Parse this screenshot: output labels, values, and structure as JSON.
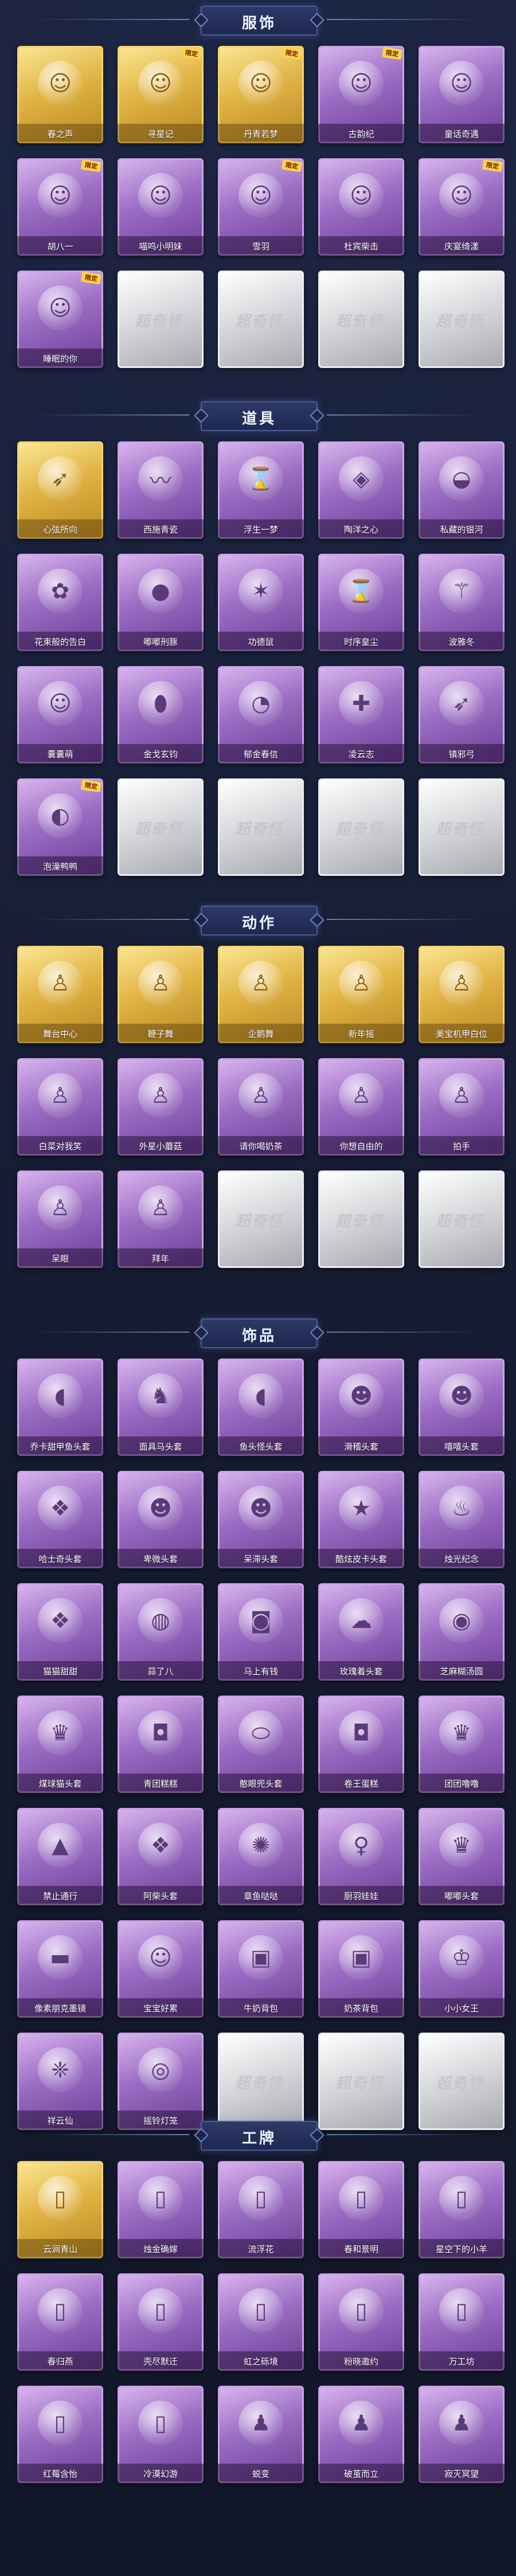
{
  "watermark": "超奇怪",
  "colors": {
    "background": "#161d33",
    "gold": "#e1b444",
    "purple": "#9a6cc3",
    "silver": "#d9dadd"
  },
  "sections": [
    {
      "title": "服饰",
      "items": [
        {
          "label": "春之声",
          "rarity": "gold",
          "icon": "character-icon",
          "tag": ""
        },
        {
          "label": "寻星记",
          "rarity": "gold",
          "icon": "character-icon",
          "tag": "限定"
        },
        {
          "label": "丹青若梦",
          "rarity": "gold",
          "icon": "character-icon",
          "tag": "限定"
        },
        {
          "label": "古韵纪",
          "rarity": "purple",
          "icon": "character-icon",
          "tag": "限定"
        },
        {
          "label": "童话奇遇",
          "rarity": "purple",
          "icon": "character-icon",
          "tag": ""
        },
        {
          "label": "胡八一",
          "rarity": "purple",
          "icon": "character-icon",
          "tag": "限定"
        },
        {
          "label": "喵呜小明妹",
          "rarity": "purple",
          "icon": "character-icon",
          "tag": ""
        },
        {
          "label": "雪羽",
          "rarity": "purple",
          "icon": "character-icon",
          "tag": "限定"
        },
        {
          "label": "杜宾柴击",
          "rarity": "purple",
          "icon": "character-icon",
          "tag": ""
        },
        {
          "label": "庆宴绮漾",
          "rarity": "purple",
          "icon": "character-icon",
          "tag": "限定"
        },
        {
          "label": "睡眠的你",
          "rarity": "purple",
          "icon": "character-icon",
          "tag": "限定"
        },
        {
          "label": "",
          "rarity": "silver",
          "icon": "",
          "tag": ""
        },
        {
          "label": "",
          "rarity": "silver",
          "icon": "",
          "tag": ""
        },
        {
          "label": "",
          "rarity": "silver",
          "icon": "",
          "tag": ""
        },
        {
          "label": "",
          "rarity": "silver",
          "icon": "",
          "tag": ""
        }
      ]
    },
    {
      "title": "道具",
      "items": [
        {
          "label": "心弦所向",
          "rarity": "gold",
          "icon": "bow-icon",
          "tag": ""
        },
        {
          "label": "西施青瓷",
          "rarity": "purple",
          "icon": "whip-icon",
          "tag": ""
        },
        {
          "label": "浮生一梦",
          "rarity": "purple",
          "icon": "hourglass-icon",
          "tag": ""
        },
        {
          "label": "陶洋之心",
          "rarity": "purple",
          "icon": "pendant-icon",
          "tag": ""
        },
        {
          "label": "私藏的银河",
          "rarity": "purple",
          "icon": "bowl-icon",
          "tag": ""
        },
        {
          "label": "花束般的告白",
          "rarity": "purple",
          "icon": "rose-icon",
          "tag": ""
        },
        {
          "label": "嘟嘟刑豚",
          "rarity": "purple",
          "icon": "pig-icon",
          "tag": ""
        },
        {
          "label": "功德鼠",
          "rarity": "purple",
          "icon": "tiger-icon",
          "tag": ""
        },
        {
          "label": "时序皇尘",
          "rarity": "purple",
          "icon": "hourglass-icon",
          "tag": ""
        },
        {
          "label": "波雅冬",
          "rarity": "purple",
          "icon": "staff-icon",
          "tag": ""
        },
        {
          "label": "囊囊萌",
          "rarity": "purple",
          "icon": "character-icon",
          "tag": ""
        },
        {
          "label": "金戈玄钧",
          "rarity": "purple",
          "icon": "grenade-icon",
          "tag": ""
        },
        {
          "label": "郁金春信",
          "rarity": "purple",
          "icon": "fan-icon",
          "tag": ""
        },
        {
          "label": "凌云志",
          "rarity": "purple",
          "icon": "crossbow-icon",
          "tag": ""
        },
        {
          "label": "镇邪弓",
          "rarity": "purple",
          "icon": "bow-icon",
          "tag": ""
        },
        {
          "label": "泡澡鸭鸭",
          "rarity": "purple",
          "icon": "duck-icon",
          "tag": "限定"
        },
        {
          "label": "",
          "rarity": "silver",
          "icon": "",
          "tag": ""
        },
        {
          "label": "",
          "rarity": "silver",
          "icon": "",
          "tag": ""
        },
        {
          "label": "",
          "rarity": "silver",
          "icon": "",
          "tag": ""
        },
        {
          "label": "",
          "rarity": "silver",
          "icon": "",
          "tag": ""
        }
      ]
    },
    {
      "title": "动作",
      "items": [
        {
          "label": "舞台中心",
          "rarity": "gold",
          "icon": "pose-icon",
          "tag": ""
        },
        {
          "label": "鞭子舞",
          "rarity": "gold",
          "icon": "pose-icon",
          "tag": ""
        },
        {
          "label": "企鹅舞",
          "rarity": "gold",
          "icon": "pose-icon",
          "tag": ""
        },
        {
          "label": "新年摇",
          "rarity": "gold",
          "icon": "pose-icon",
          "tag": ""
        },
        {
          "label": "美宝机甲白位",
          "rarity": "gold",
          "icon": "pose-icon",
          "tag": ""
        },
        {
          "label": "白菜对我笑",
          "rarity": "purple",
          "icon": "pose-icon",
          "tag": ""
        },
        {
          "label": "外星小蘑菇",
          "rarity": "purple",
          "icon": "pose-icon",
          "tag": ""
        },
        {
          "label": "请你喝奶茶",
          "rarity": "purple",
          "icon": "pose-icon",
          "tag": ""
        },
        {
          "label": "你想自由的",
          "rarity": "purple",
          "icon": "pose-icon",
          "tag": ""
        },
        {
          "label": "拍手",
          "rarity": "purple",
          "icon": "pose-icon",
          "tag": ""
        },
        {
          "label": "呆眼",
          "rarity": "purple",
          "icon": "pose-icon",
          "tag": ""
        },
        {
          "label": "拜年",
          "rarity": "purple",
          "icon": "pose-icon",
          "tag": ""
        },
        {
          "label": "",
          "rarity": "silver",
          "icon": "",
          "tag": ""
        },
        {
          "label": "",
          "rarity": "silver",
          "icon": "",
          "tag": ""
        },
        {
          "label": "",
          "rarity": "silver",
          "icon": "",
          "tag": ""
        }
      ]
    },
    {
      "title": "饰品",
      "items": [
        {
          "label": "乔卡甜甲鱼头套",
          "rarity": "purple",
          "icon": "fish-icon",
          "tag": ""
        },
        {
          "label": "面具马头套",
          "rarity": "purple",
          "icon": "horse-icon",
          "tag": ""
        },
        {
          "label": "鱼头怪头套",
          "rarity": "purple",
          "icon": "fish-icon",
          "tag": ""
        },
        {
          "label": "滑稽头套",
          "rarity": "purple",
          "icon": "emoji-icon",
          "tag": ""
        },
        {
          "label": "嘻嘻头套",
          "rarity": "purple",
          "icon": "emoji-icon",
          "tag": ""
        },
        {
          "label": "哈士奇头套",
          "rarity": "purple",
          "icon": "dog-icon",
          "tag": ""
        },
        {
          "label": "卑微头套",
          "rarity": "purple",
          "icon": "emoji-icon",
          "tag": ""
        },
        {
          "label": "呆滞头套",
          "rarity": "purple",
          "icon": "emoji-icon",
          "tag": ""
        },
        {
          "label": "酷炫皮卡头套",
          "rarity": "purple",
          "icon": "pikachu-icon",
          "tag": ""
        },
        {
          "label": "烛光纪念",
          "rarity": "purple",
          "icon": "candle-icon",
          "tag": ""
        },
        {
          "label": "猫猫甜甜",
          "rarity": "purple",
          "icon": "dog-icon",
          "tag": ""
        },
        {
          "label": "蒜了八",
          "rarity": "purple",
          "icon": "garlic-icon",
          "tag": ""
        },
        {
          "label": "马上有钱",
          "rarity": "purple",
          "icon": "bag-icon",
          "tag": ""
        },
        {
          "label": "玫瑰着头套",
          "rarity": "purple",
          "icon": "sheep-icon",
          "tag": ""
        },
        {
          "label": "芝麻糊汤圆",
          "rarity": "purple",
          "icon": "dumpling-icon",
          "tag": ""
        },
        {
          "label": "煤球猫头套",
          "rarity": "purple",
          "icon": "cat-icon",
          "tag": ""
        },
        {
          "label": "青团糕糕",
          "rarity": "purple",
          "icon": "cake-icon",
          "tag": ""
        },
        {
          "label": "憨眼兜头套",
          "rarity": "purple",
          "icon": "egg-icon",
          "tag": ""
        },
        {
          "label": "卷王蛋糕",
          "rarity": "purple",
          "icon": "cake-icon",
          "tag": ""
        },
        {
          "label": "团团噜噜",
          "rarity": "purple",
          "icon": "cat-icon",
          "tag": ""
        },
        {
          "label": "禁止通行",
          "rarity": "purple",
          "icon": "cone-icon",
          "tag": ""
        },
        {
          "label": "阿柴头套",
          "rarity": "purple",
          "icon": "dog-icon",
          "tag": ""
        },
        {
          "label": "章鱼哒哒",
          "rarity": "purple",
          "icon": "octopus-icon",
          "tag": ""
        },
        {
          "label": "厨羽娃娃",
          "rarity": "purple",
          "icon": "doll-icon",
          "tag": ""
        },
        {
          "label": "嘟嘟头套",
          "rarity": "purple",
          "icon": "cat-icon",
          "tag": ""
        },
        {
          "label": "像素朋克墨镜",
          "rarity": "purple",
          "icon": "sunglasses-icon",
          "tag": ""
        },
        {
          "label": "宝宝好累",
          "rarity": "purple",
          "icon": "baby-icon",
          "tag": ""
        },
        {
          "label": "牛奶背包",
          "rarity": "purple",
          "icon": "backpack-icon",
          "tag": ""
        },
        {
          "label": "奶茶背包",
          "rarity": "purple",
          "icon": "backpack-icon",
          "tag": ""
        },
        {
          "label": "小小女王",
          "rarity": "purple",
          "icon": "crown-icon",
          "tag": ""
        },
        {
          "label": "祥云仙",
          "rarity": "purple",
          "icon": "ornament-icon",
          "tag": ""
        },
        {
          "label": "摇铃灯笼",
          "rarity": "purple",
          "icon": "lantern-icon",
          "tag": ""
        },
        {
          "label": "",
          "rarity": "silver",
          "icon": "",
          "tag": ""
        },
        {
          "label": "",
          "rarity": "silver",
          "icon": "",
          "tag": ""
        },
        {
          "label": "",
          "rarity": "silver",
          "icon": "",
          "tag": ""
        }
      ]
    },
    {
      "title": "工牌",
      "items": [
        {
          "label": "云涧青山",
          "rarity": "gold",
          "icon": "badge-icon",
          "tag": ""
        },
        {
          "label": "烛金确嫁",
          "rarity": "purple",
          "icon": "badge-icon",
          "tag": ""
        },
        {
          "label": "流浮花",
          "rarity": "purple",
          "icon": "badge-icon",
          "tag": ""
        },
        {
          "label": "春和景明",
          "rarity": "purple",
          "icon": "badge-icon",
          "tag": ""
        },
        {
          "label": "星空下的小羊",
          "rarity": "purple",
          "icon": "badge-icon",
          "tag": ""
        },
        {
          "label": "春归燕",
          "rarity": "purple",
          "icon": "badge-icon",
          "tag": ""
        },
        {
          "label": "壳尽默迁",
          "rarity": "purple",
          "icon": "badge-icon",
          "tag": ""
        },
        {
          "label": "虹之砾境",
          "rarity": "purple",
          "icon": "badge-icon",
          "tag": ""
        },
        {
          "label": "粉晓邀约",
          "rarity": "purple",
          "icon": "badge-icon",
          "tag": ""
        },
        {
          "label": "万工坊",
          "rarity": "purple",
          "icon": "badge-icon",
          "tag": ""
        },
        {
          "label": "红莓含怡",
          "rarity": "purple",
          "icon": "badge-icon",
          "tag": ""
        },
        {
          "label": "冷漠幻游",
          "rarity": "purple",
          "icon": "badge-icon",
          "tag": ""
        },
        {
          "label": "蜕变",
          "rarity": "purple",
          "icon": "silhouette-icon",
          "tag": ""
        },
        {
          "label": "破茧而立",
          "rarity": "purple",
          "icon": "silhouette-icon",
          "tag": ""
        },
        {
          "label": "寂灭冥望",
          "rarity": "purple",
          "icon": "silhouette-icon",
          "tag": ""
        }
      ]
    }
  ]
}
